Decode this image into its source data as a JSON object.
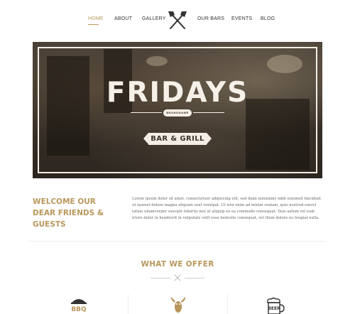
{
  "nav": {
    "items": [
      {
        "label": "HOME",
        "active": true
      },
      {
        "label": "ABOUT"
      },
      {
        "label": "GALLERY"
      },
      {
        "label": "OUR BARS"
      },
      {
        "label": "EVENTS"
      },
      {
        "label": "BLOG"
      }
    ],
    "logo_icon": "crossed-axes-icon"
  },
  "hero": {
    "title": "FRIDAYS",
    "badge": "BRANDNAME",
    "subtitle": "BAR & GRILL"
  },
  "welcome": {
    "title": "WELCOME OUR DEAR FRIENDS & GUESTS",
    "text": "Lorem ipsum dolor sit amet, consectetuer adipiscing elit, sed diam nonummy nibh euismod tincidunt ut laoreet dolore magna aliquam erat volutpat. Ut wisi enim ad minim veniam, quis nostrud exerci tation ullamcorper suscipit lobortis nisl ut aliquip ex ea commodo consequat. Duis autem vel eum iriure dolor in hendrerit in vulputate velit esse molestie consequat, vel illum dolore eu feugiat nulla."
  },
  "offer": {
    "title": "WHAT WE OFFER",
    "features": [
      {
        "icon": "bbq-icon",
        "label": "BBQ"
      },
      {
        "icon": "lobster-icon"
      },
      {
        "icon": "beer-mug-icon",
        "label": "BEER"
      }
    ]
  },
  "colors": {
    "accent": "#b8975b",
    "text": "#333333"
  }
}
